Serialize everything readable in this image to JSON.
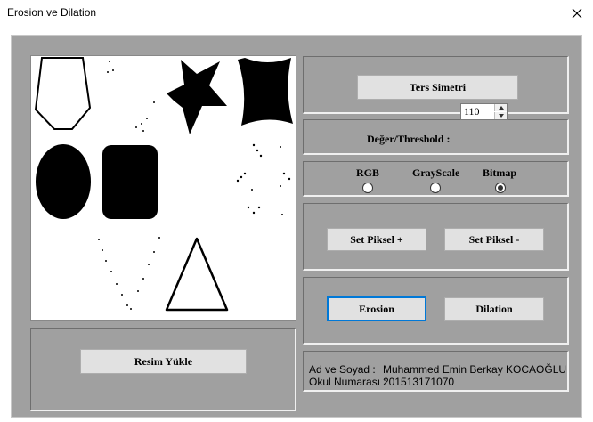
{
  "window": {
    "title": "Erosion ve Dilation"
  },
  "buttons": {
    "ters_simetri": "Ters Simetri",
    "set_piksel_plus": "Set Piksel +",
    "set_piksel_minus": "Set Piksel -",
    "erosion": "Erosion",
    "dilation": "Dilation",
    "resim_yukle": "Resim Yükle"
  },
  "threshold": {
    "label": "Değer/Threshold :",
    "value": "110"
  },
  "mode": {
    "options": [
      "RGB",
      "GrayScale",
      "Bitmap"
    ],
    "selected": "Bitmap"
  },
  "info": {
    "name_label": "Ad ve Soyad :",
    "name_value": "Muhammed Emin Berkay KOCAOĞLU",
    "number_label": "Okul Numarası :",
    "number_value": "201513171070"
  },
  "icons": {
    "close": "close-icon",
    "spin_up": "spin-up-icon",
    "spin_down": "spin-down-icon"
  },
  "colors": {
    "background": "#a0a0a0",
    "button": "#e1e1e1",
    "focus": "#0078d7"
  }
}
